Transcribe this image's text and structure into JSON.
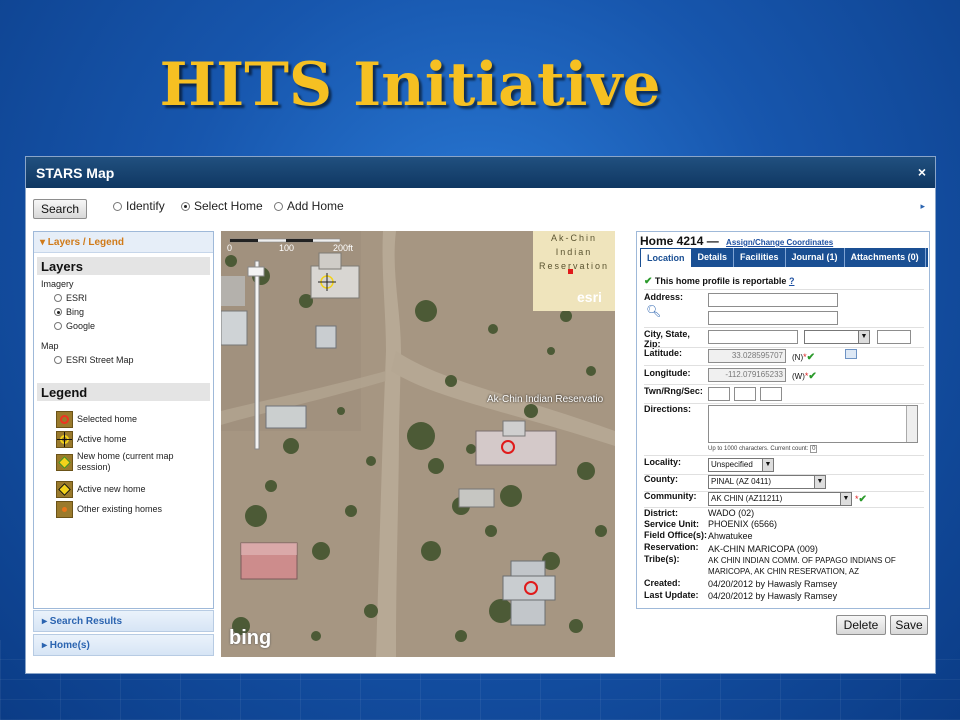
{
  "slide": {
    "title": "HITS Initiative"
  },
  "window": {
    "title": "STARS Map",
    "close": "×"
  },
  "toolbar": {
    "search_label": "Search",
    "modes": [
      {
        "label": "Identify",
        "selected": false
      },
      {
        "label": "Select Home",
        "selected": true
      },
      {
        "label": "Add Home",
        "selected": false
      }
    ],
    "expand": "▸"
  },
  "left_panel": {
    "header": "▾ Layers / Legend",
    "layers_title": "Layers",
    "imagery_label": "Imagery",
    "imagery_options": [
      {
        "label": "ESRI",
        "selected": false
      },
      {
        "label": "Bing",
        "selected": true
      },
      {
        "label": "Google",
        "selected": false
      }
    ],
    "map_label": "Map",
    "map_options": [
      {
        "label": "ESRI Street Map",
        "selected": false
      }
    ],
    "legend_title": "Legend",
    "legend_items": [
      {
        "label": "Selected home",
        "icon": "selected-home-icon"
      },
      {
        "label": "Active home",
        "icon": "active-home-icon"
      },
      {
        "label": "New home (current map session)",
        "icon": "new-home-icon"
      },
      {
        "label": "Active new home",
        "icon": "active-new-home-icon"
      },
      {
        "label": "Other existing homes",
        "icon": "other-home-icon"
      }
    ],
    "search_results": "▸  Search Results",
    "homes": "▸  Home(s)"
  },
  "map": {
    "scale_labels": [
      "0",
      "100",
      "200ft"
    ],
    "inset_lines": [
      "Ak-Chin",
      "Indian",
      "Reservation"
    ],
    "reservation_label": "Ak-Chin Indian Reservatio",
    "esri_logo": "esri",
    "bing_logo": "bing"
  },
  "home_panel": {
    "title": "Home 4214",
    "dash": " — ",
    "assign_link": "Assign/Change Coordinates",
    "tabs": [
      {
        "label": "Location",
        "active": true
      },
      {
        "label": "Details",
        "active": false
      },
      {
        "label": "Facilities",
        "active": false
      },
      {
        "label": "Journal (1)",
        "active": false
      },
      {
        "label": "Attachments (0)",
        "active": false
      }
    ],
    "reportable": "This home profile is reportable",
    "help": "?",
    "labels": {
      "address": "Address:",
      "city": "City, State,",
      "zip": "Zip:",
      "latitude": "Latitude:",
      "longitude": "Longitude:",
      "twn": "Twn/Rng/Sec:",
      "directions": "Directions:",
      "locality": "Locality:",
      "county": "County:",
      "community": "Community:",
      "district": "District:",
      "service_unit": "Service Unit:",
      "field_office": "Field Office(s):",
      "reservation": "Reservation:",
      "tribe": "Tribe(s):",
      "created": "Created:",
      "last_update": "Last Update:"
    },
    "latitude": "33.028595707",
    "lat_dir": "(N)",
    "longitude": "-112.079165233",
    "lon_dir": "(W)",
    "directions_hint": "Up to 1000 characters.  Current count:",
    "directions_count": "0",
    "locality": "Unspecified",
    "county": "PINAL (AZ 0411)",
    "community": "AK CHIN (AZ11211)",
    "district": "WADO (02)",
    "service_unit": "PHOENIX (6566)",
    "field_office": "Ahwatukee",
    "reservation": "AK-CHIN MARICOPA (009)",
    "tribe_line1": "AK CHIN INDIAN COMM. OF PAPAGO INDIANS OF",
    "tribe_line2": "MARICOPA, AK CHIN RESERVATION, AZ",
    "created": "04/20/2012 by Hawasly Ramsey",
    "last_update": "04/20/2012 by Hawasly Ramsey"
  },
  "actions": {
    "delete": "Delete",
    "save": "Save"
  }
}
